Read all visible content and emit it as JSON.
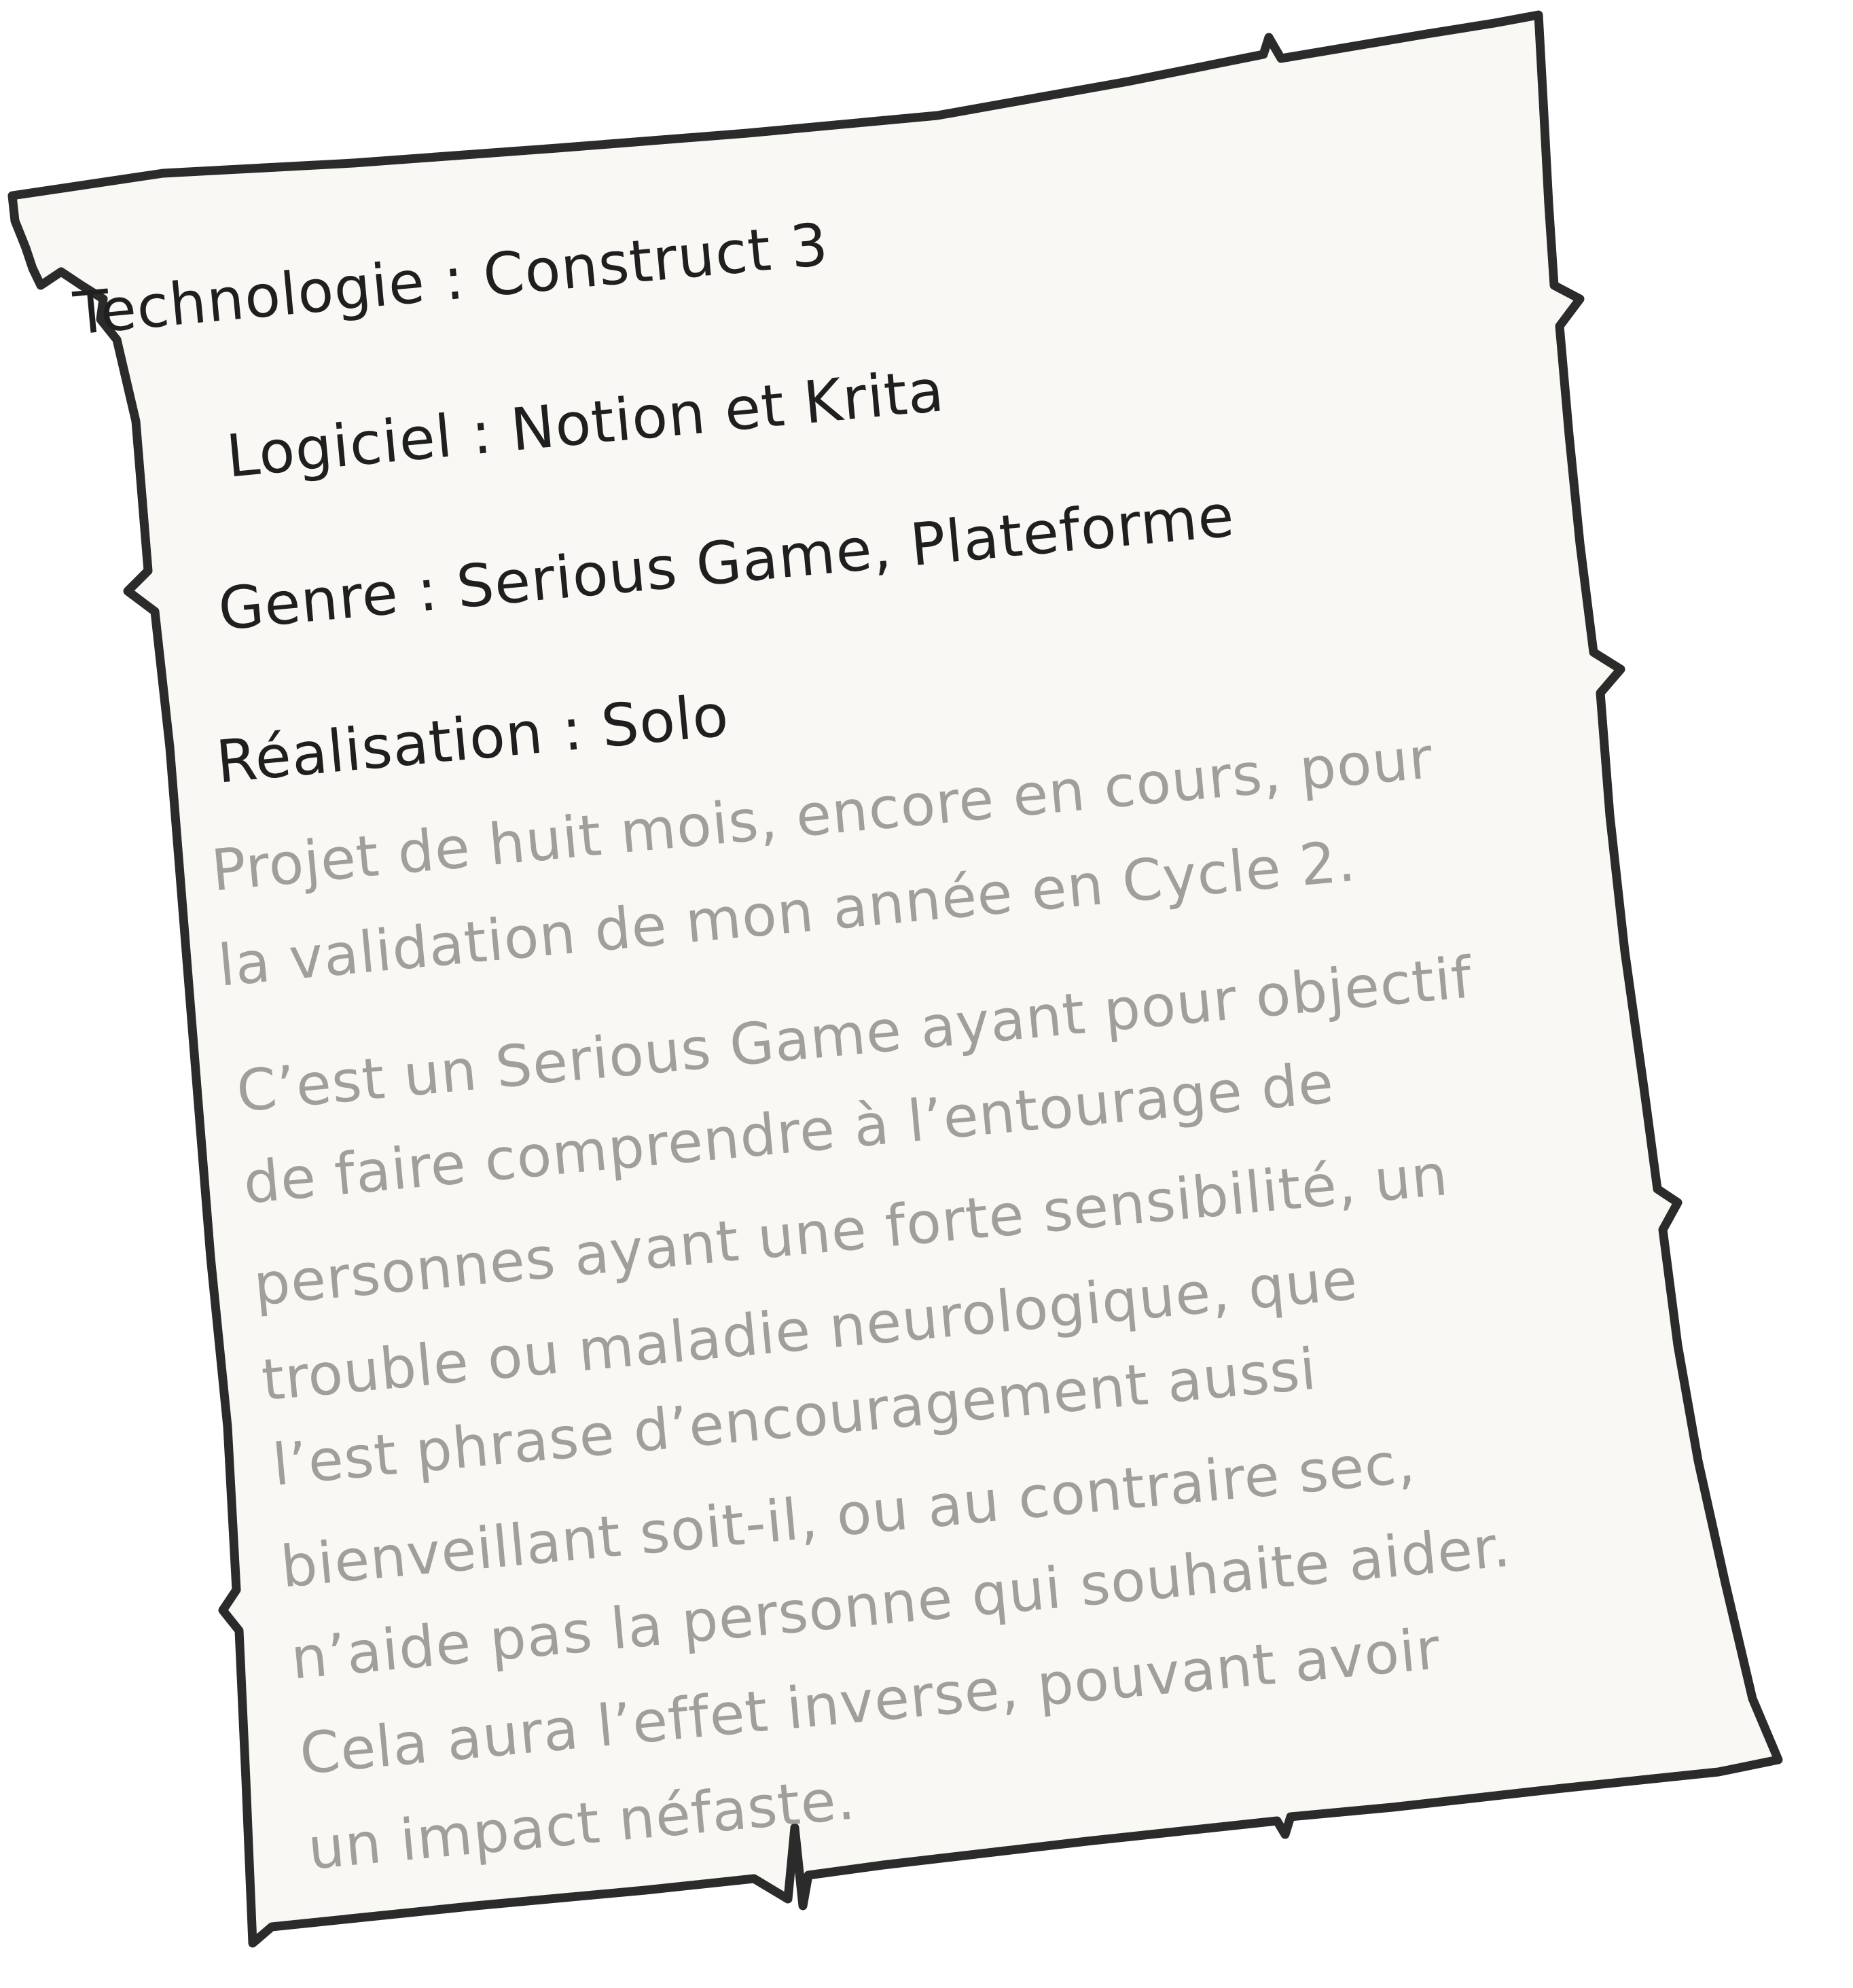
{
  "colors": {
    "paper_fill": "#f9f8f4",
    "outline": "#2b2b2b",
    "heading_text": "#1f1f1f",
    "body_text": "#a19e9b"
  },
  "card": {
    "fields": {
      "technologie": "Technologie : Construct 3",
      "logiciel": "Logiciel : Notion et Krita",
      "genre": "Genre : Serious Game, Plateforme",
      "realisation": "Réalisation : Solo"
    },
    "intro_lines": [
      "Projet de huit mois, encore en cours, pour",
      "la validation de mon année en Cycle 2."
    ],
    "description_lines": [
      "C’est un Serious Game ayant pour objectif",
      "de faire comprendre à l’entourage de",
      "personnes ayant une forte sensibilité, un",
      "trouble ou maladie neurologique, que",
      "l’est phrase d’encouragement aussi",
      "bienveillant soit-il, ou au contraire sec,",
      "n’aide pas la personne qui souhaite aider.",
      "Cela aura l’effet inverse, pouvant avoir",
      "un impact néfaste."
    ]
  }
}
